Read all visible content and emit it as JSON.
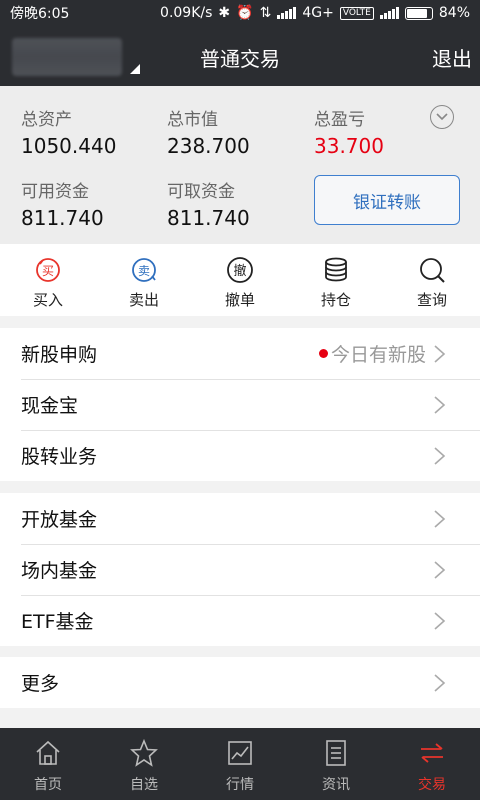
{
  "status": {
    "time": "傍晚6:05",
    "speed": "0.09K/s",
    "network": "4G+",
    "volte": "VOLTE",
    "battery": "84%",
    "battery_level": 0.84
  },
  "header": {
    "title": "普通交易",
    "exit_label": "退出"
  },
  "assets": {
    "total_assets_label": "总资产",
    "total_assets_value": "1050.440",
    "market_value_label": "总市值",
    "market_value_value": "238.700",
    "profit_label": "总盈亏",
    "profit_value": "33.700",
    "available_label": "可用资金",
    "available_value": "811.740",
    "withdrawable_label": "可取资金",
    "withdrawable_value": "811.740",
    "transfer_label": "银证转账"
  },
  "actions": [
    {
      "label": "买入",
      "icon": "buy-icon"
    },
    {
      "label": "卖出",
      "icon": "sell-icon"
    },
    {
      "label": "撤单",
      "icon": "cancel-order-icon"
    },
    {
      "label": "持仓",
      "icon": "holdings-icon"
    },
    {
      "label": "查询",
      "icon": "search-icon"
    }
  ],
  "menu": {
    "ipo": {
      "label": "新股申购",
      "hint": "今日有新股"
    },
    "cash": {
      "label": "现金宝"
    },
    "transfer_biz": {
      "label": "股转业务"
    },
    "open_fund": {
      "label": "开放基金"
    },
    "onsite_fund": {
      "label": "场内基金"
    },
    "etf_fund": {
      "label": "ETF基金"
    },
    "more": {
      "label": "更多"
    }
  },
  "tabs": [
    {
      "label": "首页",
      "icon": "home-icon"
    },
    {
      "label": "自选",
      "icon": "star-icon"
    },
    {
      "label": "行情",
      "icon": "chart-icon"
    },
    {
      "label": "资讯",
      "icon": "news-icon"
    },
    {
      "label": "交易",
      "icon": "trade-icon",
      "active": true
    }
  ],
  "colors": {
    "header_bg": "#2b2d31",
    "accent_red": "#e60012",
    "accent_blue": "#2f6fbe",
    "tab_active": "#e8342b"
  }
}
